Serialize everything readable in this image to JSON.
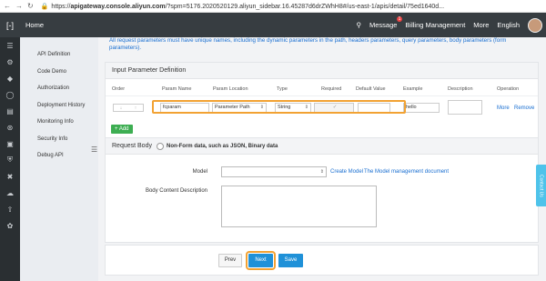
{
  "browser": {
    "url_prefix": "https://",
    "url_host": "apigateway.console.aliyun.com",
    "url_rest": "/?spm=5176.2020520129.aliyun_sidebar.16.45287d6drZWhH8#/us-east-1/apis/detail/75ed1640d..."
  },
  "topnav": {
    "home": "Home",
    "message": "Message",
    "message_count": "1",
    "billing": "Billing Management",
    "more": "More",
    "language": "English"
  },
  "sidebar": {
    "items": [
      {
        "label": "API Definition"
      },
      {
        "label": "Code Demo"
      },
      {
        "label": "Authorization"
      },
      {
        "label": "Deployment History"
      },
      {
        "label": "Monitoring Info"
      },
      {
        "label": "Security Info"
      },
      {
        "label": "Debug API"
      }
    ]
  },
  "notice": "All request parameters must have unique names, including the dynamic parameters in the path, headers parameters, query parameters, body parameters (form parameters).",
  "input_params": {
    "title": "Input Parameter Definition",
    "columns": [
      "Order",
      "Param Name",
      "Param Location",
      "Type",
      "Required",
      "Default Value",
      "Example",
      "Description",
      "Operation"
    ],
    "row": {
      "param_name": "fcparam",
      "location": "Parameter Path",
      "type": "String",
      "required_mark": "✓",
      "default_value": "",
      "example": "hello",
      "description": "",
      "more": "More",
      "remove": "Remove"
    },
    "add_label": "+ Add"
  },
  "request_body": {
    "title": "Request Body",
    "option_label": "Non-Form data, such as JSON, Binary data",
    "model_label": "Model",
    "create_model": "Create Model",
    "model_doc": "The Model management document",
    "content_desc_label": "Body Content Description"
  },
  "footer": {
    "prev": "Prev",
    "next": "Next",
    "save": "Save"
  },
  "contact": "Contact Us"
}
